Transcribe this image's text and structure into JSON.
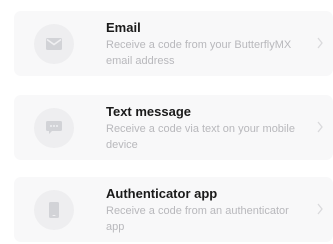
{
  "options": [
    {
      "title": "Email",
      "description": "Receive a code from your ButterflyMX email address",
      "icon": "envelope-icon"
    },
    {
      "title": "Text message",
      "description": "Receive a code via text on your mobile device",
      "icon": "chat-bubble-icon"
    },
    {
      "title": "Authenticator app",
      "description": "Receive a code from an authenticator app",
      "icon": "phone-icon"
    }
  ],
  "colors": {
    "card_background": "#f8f8f9",
    "icon_circle": "#eeeef0",
    "icon_glyph": "#d2d3d7",
    "title_text": "#1a1a1a",
    "description_text": "#b8b8bc",
    "chevron": "#d9d9dc"
  }
}
